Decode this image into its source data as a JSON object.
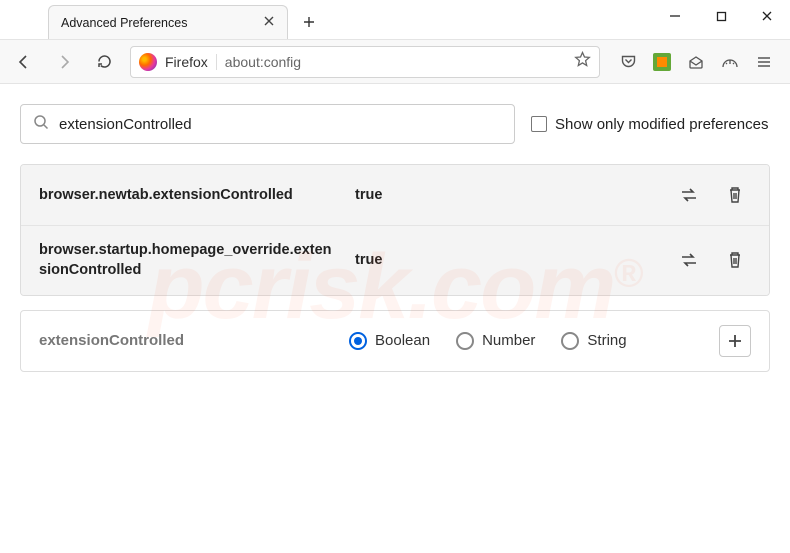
{
  "window": {
    "tab_title": "Advanced Preferences"
  },
  "url_bar": {
    "context": "Firefox",
    "url": "about:config"
  },
  "search": {
    "value": "extensionControlled"
  },
  "checkbox": {
    "label": "Show only modified preferences"
  },
  "prefs": [
    {
      "name": "browser.newtab.extensionControlled",
      "value": "true"
    },
    {
      "name": "browser.startup.homepage_override.extensionControlled",
      "value": "true"
    }
  ],
  "add": {
    "name": "extensionControlled",
    "types": [
      "Boolean",
      "Number",
      "String"
    ],
    "selected": "Boolean"
  },
  "watermark": "pcrisk.com"
}
